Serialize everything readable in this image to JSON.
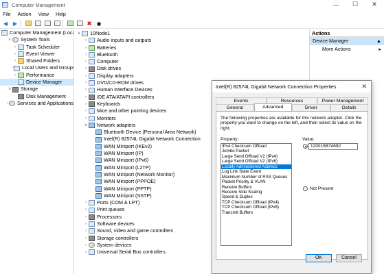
{
  "window": {
    "title": "Computer Management",
    "controls": [
      "—",
      "☐",
      "✕"
    ]
  },
  "menu": [
    "File",
    "Action",
    "View",
    "Help"
  ],
  "left_tree": [
    {
      "label": "Computer Management (Local",
      "indent": 0,
      "chev": "",
      "icon": "computer"
    },
    {
      "label": "System Tools",
      "indent": 1,
      "chev": "v",
      "icon": "gear"
    },
    {
      "label": "Task Scheduler",
      "indent": 2,
      "chev": ">",
      "icon": "clock"
    },
    {
      "label": "Event Viewer",
      "indent": 2,
      "chev": ">",
      "icon": "viewer"
    },
    {
      "label": "Shared Folders",
      "indent": 2,
      "chev": ">",
      "icon": "folder"
    },
    {
      "label": "Local Users and Groups",
      "indent": 2,
      "chev": ">",
      "icon": "users"
    },
    {
      "label": "Performance",
      "indent": 2,
      "chev": ">",
      "icon": "performance"
    },
    {
      "label": "Device Manager",
      "indent": 2,
      "chev": "",
      "icon": "device",
      "selected": true
    },
    {
      "label": "Storage",
      "indent": 1,
      "chev": "v",
      "icon": "storage"
    },
    {
      "label": "Disk Management",
      "indent": 2,
      "chev": "",
      "icon": "disk"
    },
    {
      "label": "Services and Applications",
      "indent": 1,
      "chev": ">",
      "icon": "services"
    }
  ],
  "device_tree": [
    {
      "label": "10Node1",
      "indent": 0,
      "chev": "v",
      "icon": "computer"
    },
    {
      "label": "Audio inputs and outputs",
      "indent": 1,
      "chev": ">",
      "icon": "audio"
    },
    {
      "label": "Batteries",
      "indent": 1,
      "chev": ">",
      "icon": "battery"
    },
    {
      "label": "Bluetooth",
      "indent": 1,
      "chev": ">",
      "icon": "bluetooth"
    },
    {
      "label": "Computer",
      "indent": 1,
      "chev": ">",
      "icon": "computer"
    },
    {
      "label": "Disk drives",
      "indent": 1,
      "chev": ">",
      "icon": "disk"
    },
    {
      "label": "Display adapters",
      "indent": 1,
      "chev": ">",
      "icon": "display"
    },
    {
      "label": "DVD/CD-ROM drives",
      "indent": 1,
      "chev": ">",
      "icon": "dvd"
    },
    {
      "label": "Human Interface Devices",
      "indent": 1,
      "chev": ">",
      "icon": "hid"
    },
    {
      "label": "IDE ATA/ATAPI controllers",
      "indent": 1,
      "chev": ">",
      "icon": "ide"
    },
    {
      "label": "Keyboards",
      "indent": 1,
      "chev": ">",
      "icon": "keyboard"
    },
    {
      "label": "Mice and other pointing devices",
      "indent": 1,
      "chev": ">",
      "icon": "mouse"
    },
    {
      "label": "Monitors",
      "indent": 1,
      "chev": ">",
      "icon": "monitor"
    },
    {
      "label": "Network adapters",
      "indent": 1,
      "chev": "v",
      "icon": "network"
    },
    {
      "label": "Bluetooth Device (Personal Area Network)",
      "indent": 2,
      "chev": "",
      "icon": "network"
    },
    {
      "label": "Intel(R) 82574L Gigabit Network Connection",
      "indent": 2,
      "chev": "",
      "icon": "network"
    },
    {
      "label": "WAN Miniport (IKEv2)",
      "indent": 2,
      "chev": "",
      "icon": "network"
    },
    {
      "label": "WAN Miniport (IP)",
      "indent": 2,
      "chev": "",
      "icon": "network"
    },
    {
      "label": "WAN Miniport (IPv6)",
      "indent": 2,
      "chev": "",
      "icon": "network"
    },
    {
      "label": "WAN Miniport (L2TP)",
      "indent": 2,
      "chev": "",
      "icon": "network"
    },
    {
      "label": "WAN Miniport (Network Monitor)",
      "indent": 2,
      "chev": "",
      "icon": "network"
    },
    {
      "label": "WAN Miniport (PPPOE)",
      "indent": 2,
      "chev": "",
      "icon": "network"
    },
    {
      "label": "WAN Miniport (PPTP)",
      "indent": 2,
      "chev": "",
      "icon": "network"
    },
    {
      "label": "WAN Miniport (SSTP)",
      "indent": 2,
      "chev": "",
      "icon": "network"
    },
    {
      "label": "Ports (COM & LPT)",
      "indent": 1,
      "chev": ">",
      "icon": "ports"
    },
    {
      "label": "Print queues",
      "indent": 1,
      "chev": ">",
      "icon": "printer"
    },
    {
      "label": "Processors",
      "indent": 1,
      "chev": ">",
      "icon": "processor"
    },
    {
      "label": "Software devices",
      "indent": 1,
      "chev": ">",
      "icon": "software"
    },
    {
      "label": "Sound, video and game controllers",
      "indent": 1,
      "chev": ">",
      "icon": "sound"
    },
    {
      "label": "Storage controllers",
      "indent": 1,
      "chev": ">",
      "icon": "storage"
    },
    {
      "label": "System devices",
      "indent": 1,
      "chev": ">",
      "icon": "system"
    },
    {
      "label": "Universal Serial Bus controllers",
      "indent": 1,
      "chev": ">",
      "icon": "usb"
    }
  ],
  "actions": {
    "header": "Actions",
    "selected": "Device Manager",
    "more": "More Actions"
  },
  "dialog": {
    "title": "Intel(R) 82574L Gigabit Network Connection Properties",
    "tabs_row1": [
      "Events",
      "Resources",
      "Power Management"
    ],
    "tabs_row2": [
      "General",
      "Advanced",
      "Driver",
      "Details"
    ],
    "active_tab": "Advanced",
    "description": "The following properties are available for this network adapter. Click the property you want to change on the left, and then select its value on the right.",
    "property_label": "Property:",
    "value_label": "Value:",
    "properties": [
      "IPv4 Checksum Offload",
      "Jumbo Packet",
      "Large Send Offload V2 (IPv4)",
      "Large Send Offload V2 (IPv6)",
      "Locally Administered Address",
      "Log Link State Event",
      "Maximum Number of RSS Queues",
      "Packet Priority & VLAN",
      "Receive Buffers",
      "Receive Side Scaling",
      "Speed & Duplex",
      "TCP Checksum Offload (IPv4)",
      "TCP Checksum Offload (IPv6)",
      "Transmit Buffers"
    ],
    "selected_property": "Locally Administered Address",
    "value": "120015B74692",
    "not_present_label": "Not Present",
    "ok_label": "OK",
    "cancel_label": "Cancel"
  }
}
